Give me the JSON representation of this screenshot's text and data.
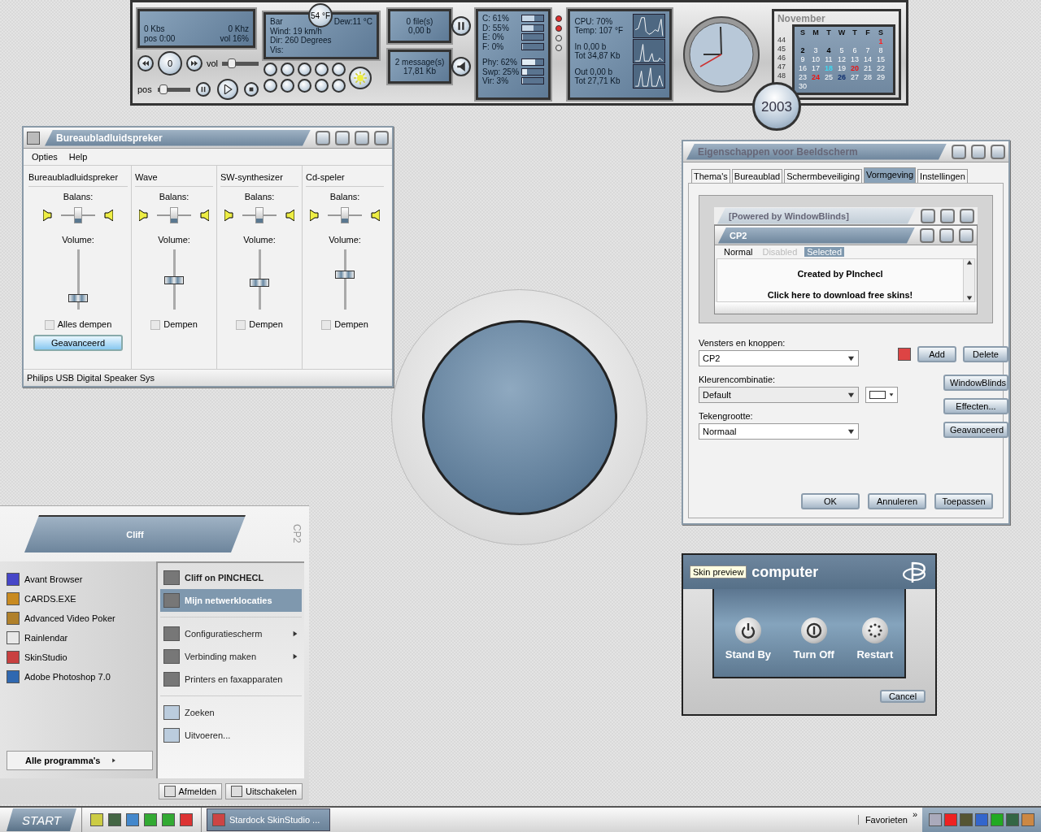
{
  "top_bar": {
    "media": {
      "bitrate": "0 Kbs",
      "frequency": "0 Khz",
      "position": "pos 0:00",
      "volume": "vol 16%",
      "counter": "0",
      "vol_label": "vol",
      "pos_label": "pos",
      "vol_slider": {
        "level": 0.2
      },
      "pos_slider": {
        "level": 0.08
      }
    },
    "weather": {
      "temperature": "54 °F",
      "station": "Bar",
      "dew": "Dew:11 °C",
      "lines": [
        "Wind: 19 km/h",
        "Dir: 260 Degrees",
        "Vis:"
      ]
    },
    "files": {
      "count": "0 file(s)",
      "size": "0,00 b"
    },
    "mail": {
      "count": "2 message(s)",
      "size": "17,81 Kb"
    },
    "drives": [
      {
        "kind": "drive",
        "label": "C: 61%",
        "level": 0.61
      },
      {
        "kind": "drive",
        "label": "D: 55%",
        "level": 0.55
      },
      {
        "kind": "drive",
        "label": "E: 0%",
        "level": 0
      },
      {
        "kind": "drive",
        "label": "F: 0%",
        "level": 0
      },
      {
        "kind": "memory",
        "label": "Phy: 62%",
        "level": 0.62
      },
      {
        "kind": "memory",
        "label": "Swp: 25%",
        "level": 0.25
      },
      {
        "kind": "memory",
        "label": "Vir: 3%",
        "level": 0.03
      }
    ],
    "indicators": [
      {
        "on": true
      },
      {
        "on": true
      },
      {
        "on": false
      },
      {
        "on": false
      }
    ],
    "system": [
      {
        "lines": [
          "CPU: 70%",
          "Temp: 107 °F"
        ]
      },
      {
        "lines": [
          "In  0,00 b",
          "Tot  34,87 Kb"
        ]
      },
      {
        "lines": [
          "Out 0,00 b",
          "Tot 27,71 Kb"
        ]
      }
    ],
    "calendar": {
      "month": "November",
      "year": "2003",
      "weekdays": [
        "S",
        "M",
        "T",
        "W",
        "T",
        "F",
        "S"
      ],
      "weeks": [
        {
          "week": "44",
          "days": [
            {
              "day": "1",
              "color": "#ff2020"
            }
          ]
        },
        {
          "week": "45",
          "days": [
            {
              "day": "2",
              "color": "#000000"
            },
            {
              "day": "3"
            },
            {
              "day": "4",
              "color": "#000000"
            },
            {
              "day": "5"
            },
            {
              "day": "6"
            },
            {
              "day": "7"
            },
            {
              "day": "8"
            }
          ]
        },
        {
          "week": "46",
          "days": [
            {
              "day": "9"
            },
            {
              "day": "10"
            },
            {
              "day": "11"
            },
            {
              "day": "12"
            },
            {
              "day": "13"
            },
            {
              "day": "14"
            },
            {
              "day": "15"
            }
          ]
        },
        {
          "week": "47",
          "days": [
            {
              "day": "16"
            },
            {
              "day": "17"
            },
            {
              "day": "18",
              "color": "#40d8f0"
            },
            {
              "day": "19"
            },
            {
              "day": "20",
              "color": "#ee1111"
            },
            {
              "day": "21"
            },
            {
              "day": "22"
            }
          ]
        },
        {
          "week": "48",
          "days": [
            {
              "day": "23"
            },
            {
              "day": "24",
              "color": "#ee1111"
            },
            {
              "day": "25"
            },
            {
              "day": "26",
              "color": "#103070"
            },
            {
              "day": "27"
            },
            {
              "day": "28"
            },
            {
              "day": "29"
            }
          ]
        },
        {
          "days": [
            {
              "day": "30"
            }
          ]
        }
      ]
    }
  },
  "mixer": {
    "title": "Bureaubladluidspreker",
    "menu": [
      "Opties",
      "Help"
    ],
    "channels": [
      {
        "name": "Bureaubladluidspreker",
        "balance_label": "Balans:",
        "balance": {
          "level": 0.5
        },
        "volume_label": "Volume:",
        "level": 0.15,
        "mute_label": "Alles dempen",
        "muted": false,
        "button": "Geavanceerd"
      },
      {
        "name": "Wave",
        "balance_label": "Balans:",
        "balance": {
          "level": 0.5
        },
        "volume_label": "Volume:",
        "level": 0.5,
        "mute_label": "Dempen",
        "muted": false
      },
      {
        "name": "SW-synthesizer",
        "balance_label": "Balans:",
        "balance": {
          "level": 0.5
        },
        "volume_label": "Volume:",
        "level": 0.45,
        "mute_label": "Dempen",
        "muted": false
      },
      {
        "name": "Cd-speler",
        "balance_label": "Balans:",
        "balance": {
          "level": 0.5
        },
        "volume_label": "Volume:",
        "level": 0.62,
        "mute_label": "Dempen",
        "muted": false
      }
    ],
    "status": "Philips USB Digital Speaker Sys"
  },
  "display": {
    "title": "Eigenschappen voor Beeldscherm",
    "tabs": [
      {
        "label": "Thema's",
        "selected": false
      },
      {
        "label": "Bureaublad",
        "selected": false
      },
      {
        "label": "Schermbeveiliging",
        "selected": false
      },
      {
        "label": "Vormgeving",
        "selected": true
      },
      {
        "label": "Instellingen",
        "selected": false
      }
    ],
    "preview": {
      "inactive_title": "[Powered by WindowBlinds]",
      "active_title": "CP2",
      "menu": [
        {
          "label": "Normal",
          "kind": "normal"
        },
        {
          "label": "Disabled",
          "kind": "disabled"
        },
        {
          "label": "Selected",
          "kind": "selected"
        }
      ],
      "lines": [
        "Created by PInchecl",
        "Click here to download free skins!"
      ]
    },
    "fields": [
      {
        "label": "Vensters en knoppen:",
        "value": "CP2",
        "disabled": false
      },
      {
        "label": "Kleurencombinatie:",
        "value": "Default",
        "disabled": true
      },
      {
        "label": "Tekengrootte:",
        "value": "Normaal",
        "disabled": false
      }
    ],
    "row_buttons": [
      "Add",
      "Delete"
    ],
    "side_buttons": [
      "WindowBlinds",
      "Effecten...",
      "Geavanceerd"
    ],
    "footer_buttons": [
      "OK",
      "Annuleren",
      "Toepassen"
    ]
  },
  "start_menu": {
    "user": "Cliff",
    "brand": "CP2",
    "programs": [
      "Avant Browser",
      "CARDS.EXE",
      "Advanced Video Poker",
      "Rainlendar",
      "SkinStudio",
      "Adobe Photoshop 7.0"
    ],
    "all_programs": "Alle programma's",
    "places": [
      {
        "label": "Cliff on PINCHECL",
        "bold": true,
        "selected": false,
        "submenu": false,
        "separator_before": false
      },
      {
        "label": "Mijn netwerklocaties",
        "bold": true,
        "selected": true,
        "submenu": false,
        "separator_before": false
      },
      {
        "label": "Configuratiescherm",
        "bold": false,
        "selected": false,
        "submenu": true,
        "separator_before": true
      },
      {
        "label": "Verbinding maken",
        "bold": false,
        "selected": false,
        "submenu": true,
        "separator_before": false
      },
      {
        "label": "Printers en faxapparaten",
        "bold": false,
        "selected": false,
        "submenu": false,
        "separator_before": false
      },
      {
        "label": "Zoeken",
        "bold": false,
        "selected": false,
        "submenu": false,
        "separator_before": true
      },
      {
        "label": "Uitvoeren...",
        "bold": false,
        "selected": false,
        "submenu": false,
        "separator_before": false
      }
    ],
    "bottom_buttons": [
      "Afmelden",
      "Uitschakelen"
    ]
  },
  "shutdown": {
    "title": "computer",
    "tooltip": "Skin preview",
    "options": [
      "Stand By",
      "Turn Off",
      "Restart"
    ],
    "cancel": "Cancel"
  },
  "taskbar": {
    "start": "START",
    "task": "Stardock SkinStudio ...",
    "toolbar": "Favorieten",
    "chevron": "»"
  }
}
